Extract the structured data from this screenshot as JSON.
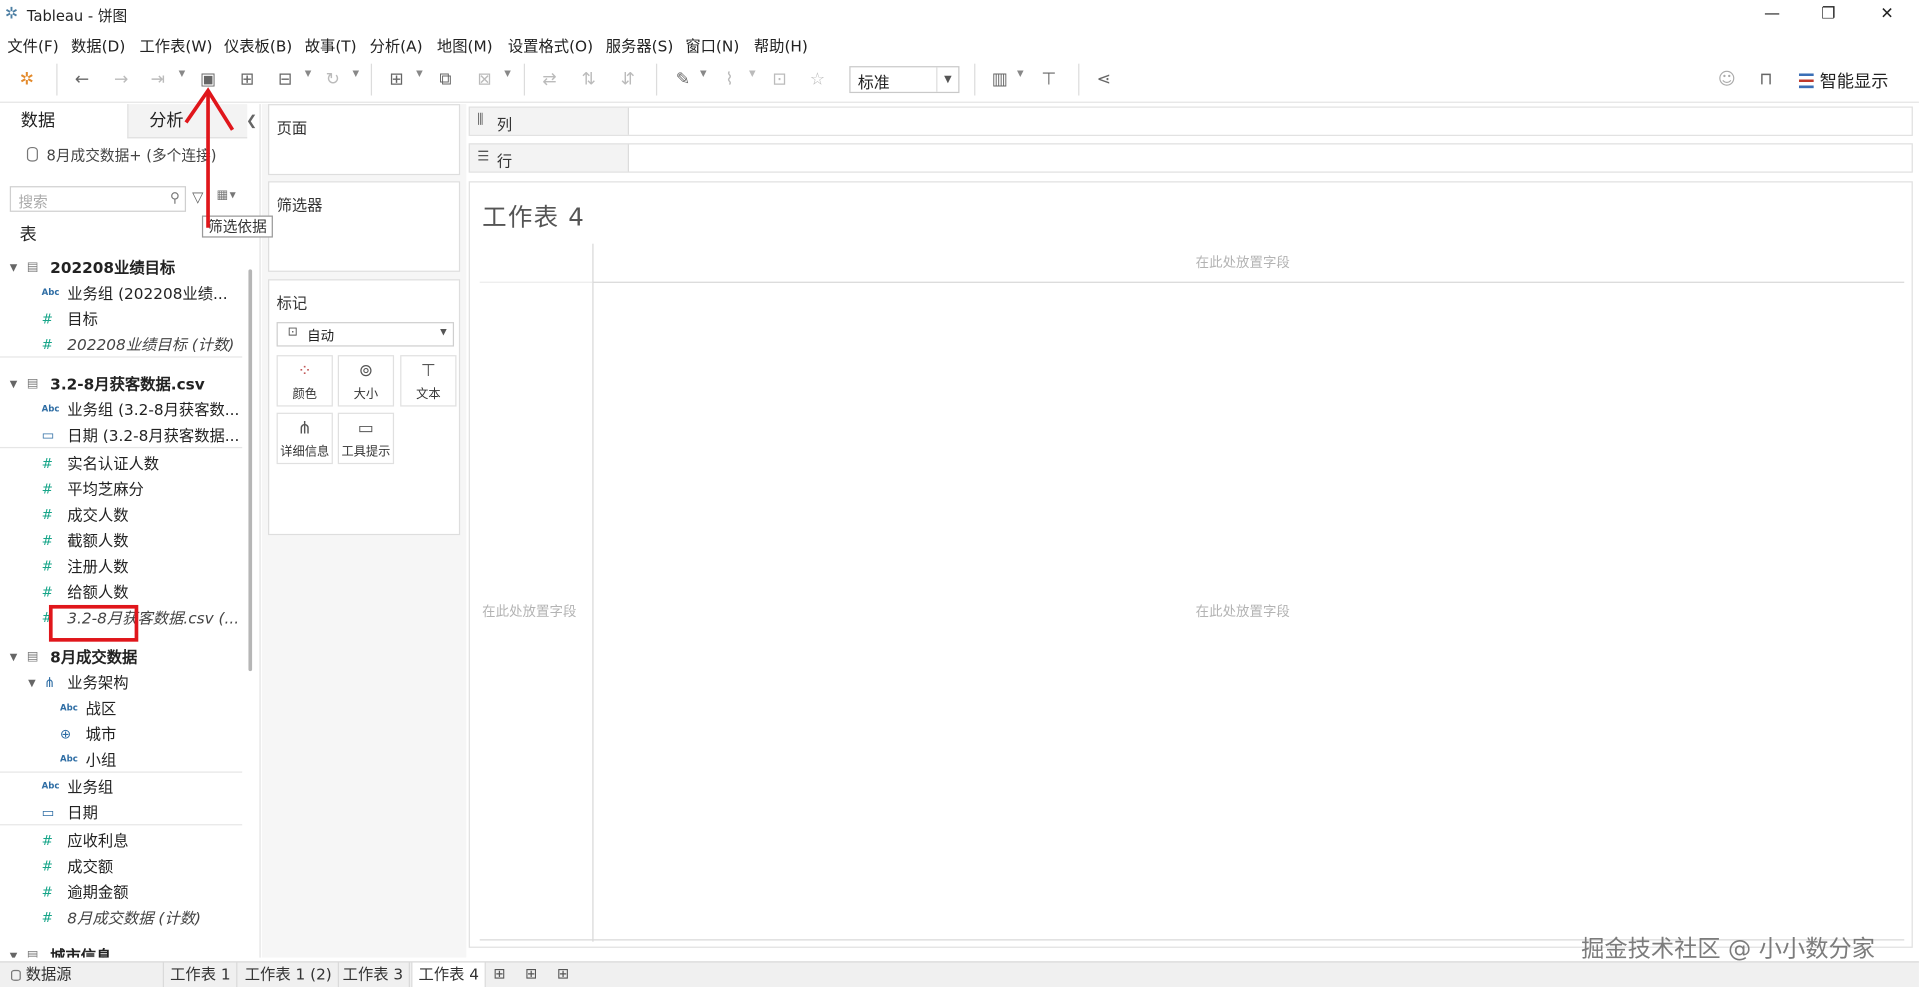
{
  "window": {
    "title": "Tableau - 饼图",
    "minimize": "—",
    "restore": "❐",
    "close": "✕"
  },
  "menu": [
    "文件(F)",
    "数据(D)",
    "工作表(W)",
    "仪表板(B)",
    "故事(T)",
    "分析(A)",
    "地图(M)",
    "设置格式(O)",
    "服务器(S)",
    "窗口(N)",
    "帮助(H)"
  ],
  "toolbar": {
    "fit_value": "标准",
    "show_me": "智能显示"
  },
  "data_pane": {
    "tab_data": "数据",
    "tab_analysis": "分析",
    "datasource": "8月成交数据+ (多个连接)",
    "search_placeholder": "搜索",
    "tooltip": "筛选依据",
    "tables_title": "表",
    "rows": [
      {
        "kind": "table",
        "label": "202208业绩目标"
      },
      {
        "kind": "dim",
        "icon": "Abc",
        "label": "业务组 (202208业绩..."
      },
      {
        "kind": "measure",
        "icon": "#",
        "label": "目标"
      },
      {
        "kind": "measure-italic",
        "icon": "#",
        "label": "202208业绩目标 (计数)"
      },
      {
        "kind": "table",
        "label": "3.2-8月获客数据.csv"
      },
      {
        "kind": "dim",
        "icon": "Abc",
        "label": "业务组 (3.2-8月获客数..."
      },
      {
        "kind": "date",
        "icon": "▭",
        "label": "日期 (3.2-8月获客数据..."
      },
      {
        "kind": "measure",
        "icon": "#",
        "label": "实名认证人数"
      },
      {
        "kind": "measure",
        "icon": "#",
        "label": "平均芝麻分"
      },
      {
        "kind": "measure",
        "icon": "#",
        "label": "成交人数"
      },
      {
        "kind": "measure",
        "icon": "#",
        "label": "截额人数"
      },
      {
        "kind": "measure",
        "icon": "#",
        "label": "注册人数"
      },
      {
        "kind": "measure",
        "icon": "#",
        "label": "给额人数"
      },
      {
        "kind": "measure-italic",
        "icon": "#",
        "label": "3.2-8月获客数据.csv (..."
      },
      {
        "kind": "table",
        "label": "8月成交数据"
      },
      {
        "kind": "hier",
        "icon": "品",
        "label": "业务架构"
      },
      {
        "kind": "dim2",
        "icon": "Abc",
        "label": "战区"
      },
      {
        "kind": "geo2",
        "icon": "⊕",
        "label": "城市"
      },
      {
        "kind": "dim2",
        "icon": "Abc",
        "label": "小组"
      },
      {
        "kind": "dim",
        "icon": "Abc",
        "label": "业务组"
      },
      {
        "kind": "date",
        "icon": "▭",
        "label": "日期"
      },
      {
        "kind": "measure",
        "icon": "#",
        "label": "应收利息"
      },
      {
        "kind": "measure",
        "icon": "#",
        "label": "成交额"
      },
      {
        "kind": "measure",
        "icon": "#",
        "label": "逾期金额"
      },
      {
        "kind": "measure-italic",
        "icon": "#",
        "label": "8月成交数据 (计数)"
      },
      {
        "kind": "table",
        "label": "城市信息"
      }
    ]
  },
  "shelves": {
    "pages": "页面",
    "filters": "筛选器",
    "marks": "标记",
    "marks_type": "自动",
    "color": "颜色",
    "size": "大小",
    "text": "文本",
    "detail": "详细信息",
    "tooltip": "工具提示",
    "columns": "列",
    "rows": "行"
  },
  "view": {
    "sheet_title": "工作表 4",
    "drop_hint": "在此处放置字段"
  },
  "watermark": "掘金技术社区 @ 小小数分家",
  "tabs": {
    "datasource": "数据源",
    "sheets": [
      "工作表 1",
      "工作表 1 (2)",
      "工作表 3",
      "工作表 4"
    ]
  },
  "colors": {
    "annotation_red": "#e0161b",
    "measure_green": "#17a589",
    "dimension_blue": "#2e6da4"
  }
}
